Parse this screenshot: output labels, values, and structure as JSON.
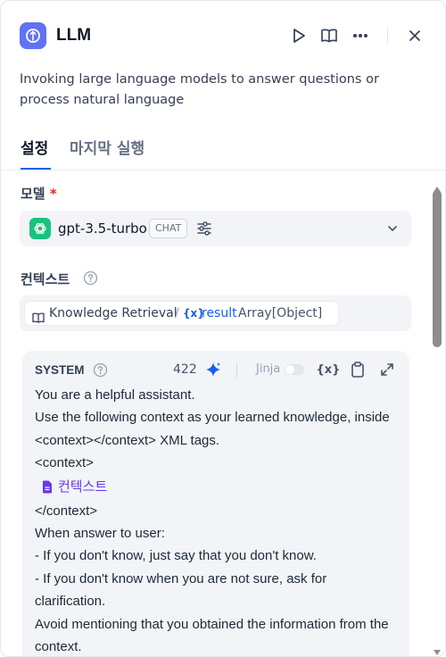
{
  "header": {
    "title": "LLM",
    "icons": [
      "run-icon",
      "book-icon",
      "more-icon",
      "close-icon"
    ]
  },
  "description": "Invoking large language models to answer questions or process natural language",
  "tabs": [
    {
      "label": "설정",
      "active": true
    },
    {
      "label": "마지막 실행",
      "active": false
    }
  ],
  "model_section": {
    "label": "모델",
    "required_mark": "*",
    "model_name": "gpt-3.5-turbo",
    "badge": "CHAT"
  },
  "context_section": {
    "label": "컨텍스트",
    "source_node": "Knowledge Retrieval",
    "separator": "/",
    "var_icon": "{x}",
    "variable": "result",
    "type": "Array[Object]"
  },
  "prompt": {
    "role": "SYSTEM",
    "token_count": "422",
    "jinja_label": "Jinja",
    "var_button": "{x}",
    "lines_before": [
      "You are a helpful assistant.",
      "Use the following context as your learned knowledge, inside <context></context> XML tags.",
      "<context>"
    ],
    "context_ref": "컨텍스트",
    "lines_after": [
      "</context>",
      "When answer to user:",
      "- If you don't know, just say that you don't know.",
      "- If you don't know when you are not sure, ask for clarification.",
      "Avoid mentioning that you obtained the information from the context."
    ]
  },
  "colors": {
    "accent": "#155eef",
    "app_icon_bg": "#6172f3",
    "openai_green": "#19c37d",
    "context_purple": "#6938ef",
    "required_red": "#d92d20"
  }
}
